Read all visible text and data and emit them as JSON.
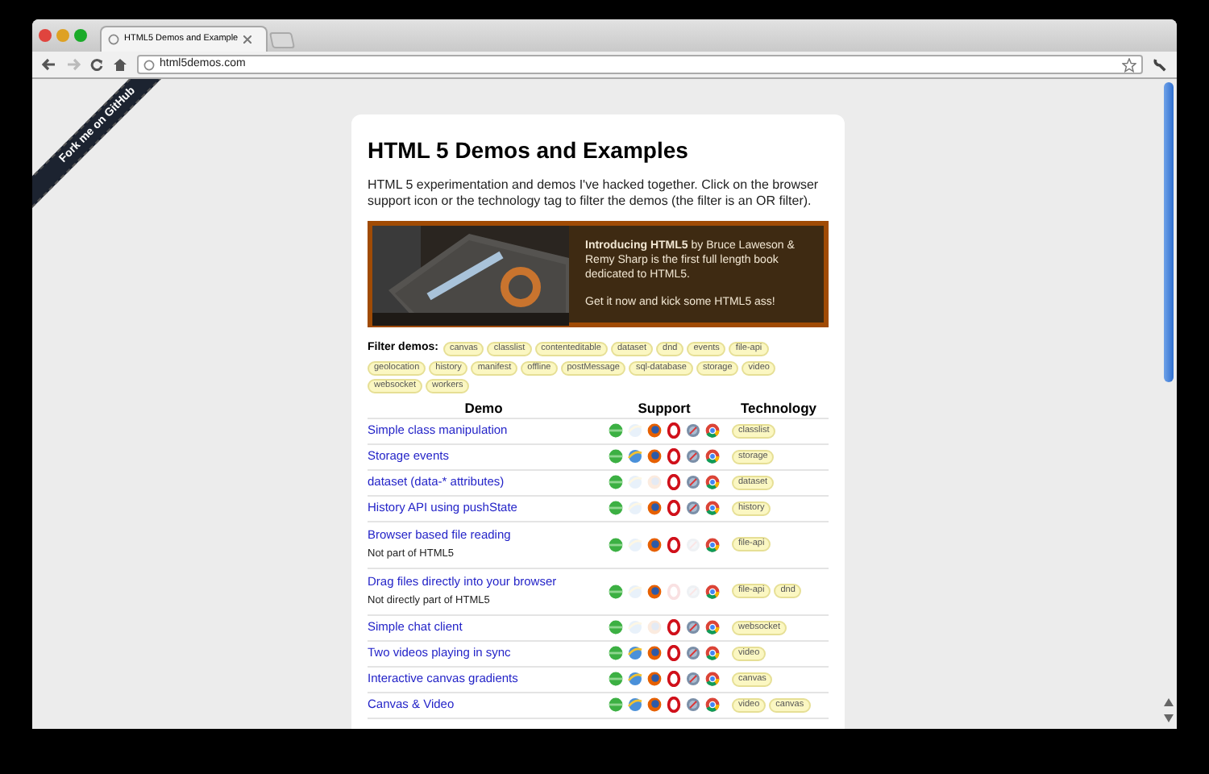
{
  "browser": {
    "tab_title": "HTML5 Demos and Example",
    "address": "html5demos.com"
  },
  "ribbon": "Fork me on GitHub",
  "page": {
    "title": "HTML 5 Demos and Examples",
    "intro": "HTML 5 experimentation and demos I've hacked together. Click on the browser support icon or the technology tag to filter the demos (the filter is an OR filter).",
    "promo": {
      "lines": [
        "**Introducing HTML5** by Bruce Laweson & Remy Sharp is the first full length book dedicated to HTML5.",
        "Get it now and kick some HTML5 ass!"
      ]
    },
    "filter_label": "Filter demos:",
    "filters": [
      "canvas",
      "classlist",
      "contenteditable",
      "dataset",
      "dnd",
      "events",
      "file-api",
      "geolocation",
      "history",
      "manifest",
      "offline",
      "postMessage",
      "sql-database",
      "storage",
      "video",
      "websocket",
      "workers"
    ],
    "columns": [
      "Demo",
      "Support",
      "Technology"
    ],
    "rows": [
      {
        "title": "Simple class manipulation",
        "support": [
          {
            "kind": "dot",
            "supported": true
          },
          {
            "kind": "globe",
            "supported": false
          },
          {
            "kind": "fox",
            "supported": true
          },
          {
            "kind": "ring",
            "supported": true
          },
          {
            "kind": "compass",
            "supported": true
          },
          {
            "kind": "wheel",
            "supported": true
          }
        ],
        "tags": [
          "classlist"
        ]
      },
      {
        "title": "Storage events",
        "support": [
          {
            "kind": "dot",
            "supported": true
          },
          {
            "kind": "globe",
            "supported": true
          },
          {
            "kind": "fox",
            "supported": true
          },
          {
            "kind": "ring",
            "supported": true
          },
          {
            "kind": "compass",
            "supported": true
          },
          {
            "kind": "wheel",
            "supported": true
          }
        ],
        "tags": [
          "storage"
        ]
      },
      {
        "title": "dataset (data-* attributes)",
        "support": [
          {
            "kind": "dot",
            "supported": true
          },
          {
            "kind": "globe",
            "supported": false
          },
          {
            "kind": "fox",
            "supported": false
          },
          {
            "kind": "ring",
            "supported": true
          },
          {
            "kind": "compass",
            "supported": true
          },
          {
            "kind": "wheel",
            "supported": true
          }
        ],
        "tags": [
          "dataset"
        ]
      },
      {
        "title": "History API using pushState",
        "support": [
          {
            "kind": "dot",
            "supported": true
          },
          {
            "kind": "globe",
            "supported": false
          },
          {
            "kind": "fox",
            "supported": true
          },
          {
            "kind": "ring",
            "supported": true
          },
          {
            "kind": "compass",
            "supported": true
          },
          {
            "kind": "wheel",
            "supported": true
          }
        ],
        "tags": [
          "history"
        ]
      },
      {
        "title": "Browser based file reading",
        "note": "Not part of HTML5",
        "support": [
          {
            "kind": "dot",
            "supported": true
          },
          {
            "kind": "globe",
            "supported": false
          },
          {
            "kind": "fox",
            "supported": true
          },
          {
            "kind": "ring",
            "supported": true
          },
          {
            "kind": "compass",
            "supported": false
          },
          {
            "kind": "wheel",
            "supported": true
          }
        ],
        "tags": [
          "file-api"
        ]
      },
      {
        "title": "Drag files directly into your browser",
        "note": "Not directly part of HTML5",
        "support": [
          {
            "kind": "dot",
            "supported": true
          },
          {
            "kind": "globe",
            "supported": false
          },
          {
            "kind": "fox",
            "supported": true
          },
          {
            "kind": "ring",
            "supported": false
          },
          {
            "kind": "compass",
            "supported": false
          },
          {
            "kind": "wheel",
            "supported": true
          }
        ],
        "tags": [
          "file-api",
          "dnd"
        ]
      },
      {
        "title": "Simple chat client",
        "support": [
          {
            "kind": "dot",
            "supported": true
          },
          {
            "kind": "globe",
            "supported": false
          },
          {
            "kind": "fox",
            "supported": false
          },
          {
            "kind": "ring",
            "supported": true
          },
          {
            "kind": "compass",
            "supported": true
          },
          {
            "kind": "wheel",
            "supported": true
          }
        ],
        "tags": [
          "websocket"
        ]
      },
      {
        "title": "Two videos playing in sync",
        "support": [
          {
            "kind": "dot",
            "supported": true
          },
          {
            "kind": "globe",
            "supported": true
          },
          {
            "kind": "fox",
            "supported": true
          },
          {
            "kind": "ring",
            "supported": true
          },
          {
            "kind": "compass",
            "supported": true
          },
          {
            "kind": "wheel",
            "supported": true
          }
        ],
        "tags": [
          "video"
        ]
      },
      {
        "title": "Interactive canvas gradients",
        "support": [
          {
            "kind": "dot",
            "supported": true
          },
          {
            "kind": "globe",
            "supported": true
          },
          {
            "kind": "fox",
            "supported": true
          },
          {
            "kind": "ring",
            "supported": true
          },
          {
            "kind": "compass",
            "supported": true
          },
          {
            "kind": "wheel",
            "supported": true
          }
        ],
        "tags": [
          "canvas"
        ]
      },
      {
        "title": "Canvas & Video",
        "support": [
          {
            "kind": "dot",
            "supported": true
          },
          {
            "kind": "globe",
            "supported": true
          },
          {
            "kind": "fox",
            "supported": true
          },
          {
            "kind": "ring",
            "supported": true
          },
          {
            "kind": "compass",
            "supported": true
          },
          {
            "kind": "wheel",
            "supported": true
          }
        ],
        "tags": [
          "video",
          "canvas"
        ]
      }
    ]
  }
}
